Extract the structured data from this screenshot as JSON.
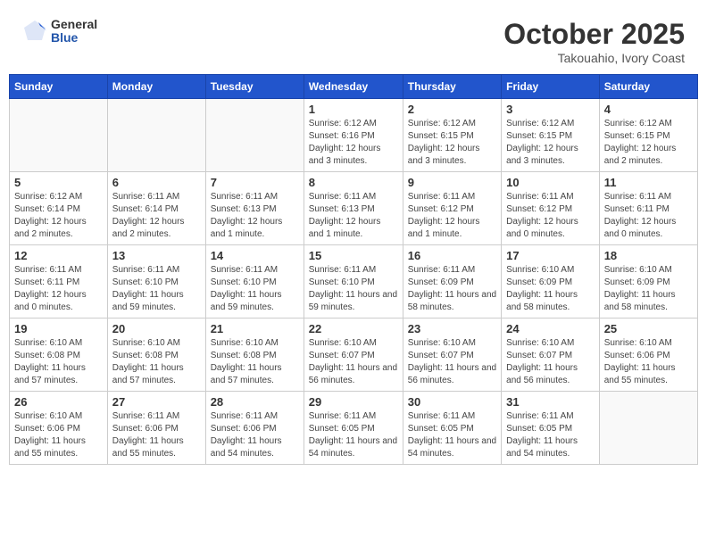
{
  "header": {
    "logo_general": "General",
    "logo_blue": "Blue",
    "month_title": "October 2025",
    "location": "Takouahio, Ivory Coast"
  },
  "weekdays": [
    "Sunday",
    "Monday",
    "Tuesday",
    "Wednesday",
    "Thursday",
    "Friday",
    "Saturday"
  ],
  "weeks": [
    [
      {
        "day": "",
        "info": ""
      },
      {
        "day": "",
        "info": ""
      },
      {
        "day": "",
        "info": ""
      },
      {
        "day": "1",
        "info": "Sunrise: 6:12 AM\nSunset: 6:16 PM\nDaylight: 12 hours and 3 minutes."
      },
      {
        "day": "2",
        "info": "Sunrise: 6:12 AM\nSunset: 6:15 PM\nDaylight: 12 hours and 3 minutes."
      },
      {
        "day": "3",
        "info": "Sunrise: 6:12 AM\nSunset: 6:15 PM\nDaylight: 12 hours and 3 minutes."
      },
      {
        "day": "4",
        "info": "Sunrise: 6:12 AM\nSunset: 6:15 PM\nDaylight: 12 hours and 2 minutes."
      }
    ],
    [
      {
        "day": "5",
        "info": "Sunrise: 6:12 AM\nSunset: 6:14 PM\nDaylight: 12 hours and 2 minutes."
      },
      {
        "day": "6",
        "info": "Sunrise: 6:11 AM\nSunset: 6:14 PM\nDaylight: 12 hours and 2 minutes."
      },
      {
        "day": "7",
        "info": "Sunrise: 6:11 AM\nSunset: 6:13 PM\nDaylight: 12 hours and 1 minute."
      },
      {
        "day": "8",
        "info": "Sunrise: 6:11 AM\nSunset: 6:13 PM\nDaylight: 12 hours and 1 minute."
      },
      {
        "day": "9",
        "info": "Sunrise: 6:11 AM\nSunset: 6:12 PM\nDaylight: 12 hours and 1 minute."
      },
      {
        "day": "10",
        "info": "Sunrise: 6:11 AM\nSunset: 6:12 PM\nDaylight: 12 hours and 0 minutes."
      },
      {
        "day": "11",
        "info": "Sunrise: 6:11 AM\nSunset: 6:11 PM\nDaylight: 12 hours and 0 minutes."
      }
    ],
    [
      {
        "day": "12",
        "info": "Sunrise: 6:11 AM\nSunset: 6:11 PM\nDaylight: 12 hours and 0 minutes."
      },
      {
        "day": "13",
        "info": "Sunrise: 6:11 AM\nSunset: 6:10 PM\nDaylight: 11 hours and 59 minutes."
      },
      {
        "day": "14",
        "info": "Sunrise: 6:11 AM\nSunset: 6:10 PM\nDaylight: 11 hours and 59 minutes."
      },
      {
        "day": "15",
        "info": "Sunrise: 6:11 AM\nSunset: 6:10 PM\nDaylight: 11 hours and 59 minutes."
      },
      {
        "day": "16",
        "info": "Sunrise: 6:11 AM\nSunset: 6:09 PM\nDaylight: 11 hours and 58 minutes."
      },
      {
        "day": "17",
        "info": "Sunrise: 6:10 AM\nSunset: 6:09 PM\nDaylight: 11 hours and 58 minutes."
      },
      {
        "day": "18",
        "info": "Sunrise: 6:10 AM\nSunset: 6:09 PM\nDaylight: 11 hours and 58 minutes."
      }
    ],
    [
      {
        "day": "19",
        "info": "Sunrise: 6:10 AM\nSunset: 6:08 PM\nDaylight: 11 hours and 57 minutes."
      },
      {
        "day": "20",
        "info": "Sunrise: 6:10 AM\nSunset: 6:08 PM\nDaylight: 11 hours and 57 minutes."
      },
      {
        "day": "21",
        "info": "Sunrise: 6:10 AM\nSunset: 6:08 PM\nDaylight: 11 hours and 57 minutes."
      },
      {
        "day": "22",
        "info": "Sunrise: 6:10 AM\nSunset: 6:07 PM\nDaylight: 11 hours and 56 minutes."
      },
      {
        "day": "23",
        "info": "Sunrise: 6:10 AM\nSunset: 6:07 PM\nDaylight: 11 hours and 56 minutes."
      },
      {
        "day": "24",
        "info": "Sunrise: 6:10 AM\nSunset: 6:07 PM\nDaylight: 11 hours and 56 minutes."
      },
      {
        "day": "25",
        "info": "Sunrise: 6:10 AM\nSunset: 6:06 PM\nDaylight: 11 hours and 55 minutes."
      }
    ],
    [
      {
        "day": "26",
        "info": "Sunrise: 6:10 AM\nSunset: 6:06 PM\nDaylight: 11 hours and 55 minutes."
      },
      {
        "day": "27",
        "info": "Sunrise: 6:11 AM\nSunset: 6:06 PM\nDaylight: 11 hours and 55 minutes."
      },
      {
        "day": "28",
        "info": "Sunrise: 6:11 AM\nSunset: 6:06 PM\nDaylight: 11 hours and 54 minutes."
      },
      {
        "day": "29",
        "info": "Sunrise: 6:11 AM\nSunset: 6:05 PM\nDaylight: 11 hours and 54 minutes."
      },
      {
        "day": "30",
        "info": "Sunrise: 6:11 AM\nSunset: 6:05 PM\nDaylight: 11 hours and 54 minutes."
      },
      {
        "day": "31",
        "info": "Sunrise: 6:11 AM\nSunset: 6:05 PM\nDaylight: 11 hours and 54 minutes."
      },
      {
        "day": "",
        "info": ""
      }
    ]
  ]
}
